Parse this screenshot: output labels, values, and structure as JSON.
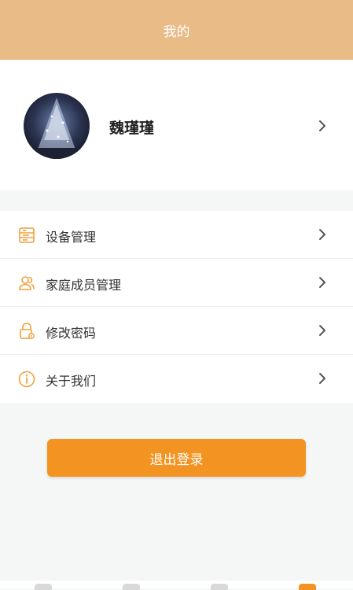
{
  "header": {
    "title": "我的"
  },
  "profile": {
    "name": "魏瑾瑾"
  },
  "menu": {
    "items": [
      {
        "label": "设备管理",
        "icon": "device-list-icon"
      },
      {
        "label": "家庭成员管理",
        "icon": "family-members-icon"
      },
      {
        "label": "修改密码",
        "icon": "lock-settings-icon"
      },
      {
        "label": "关于我们",
        "icon": "info-icon"
      }
    ]
  },
  "logout": {
    "label": "退出登录"
  },
  "colors": {
    "header_bg": "#e8bb87",
    "accent": "#f39422",
    "icon": "#f0a13c",
    "page_bg": "#f5f6f6"
  }
}
